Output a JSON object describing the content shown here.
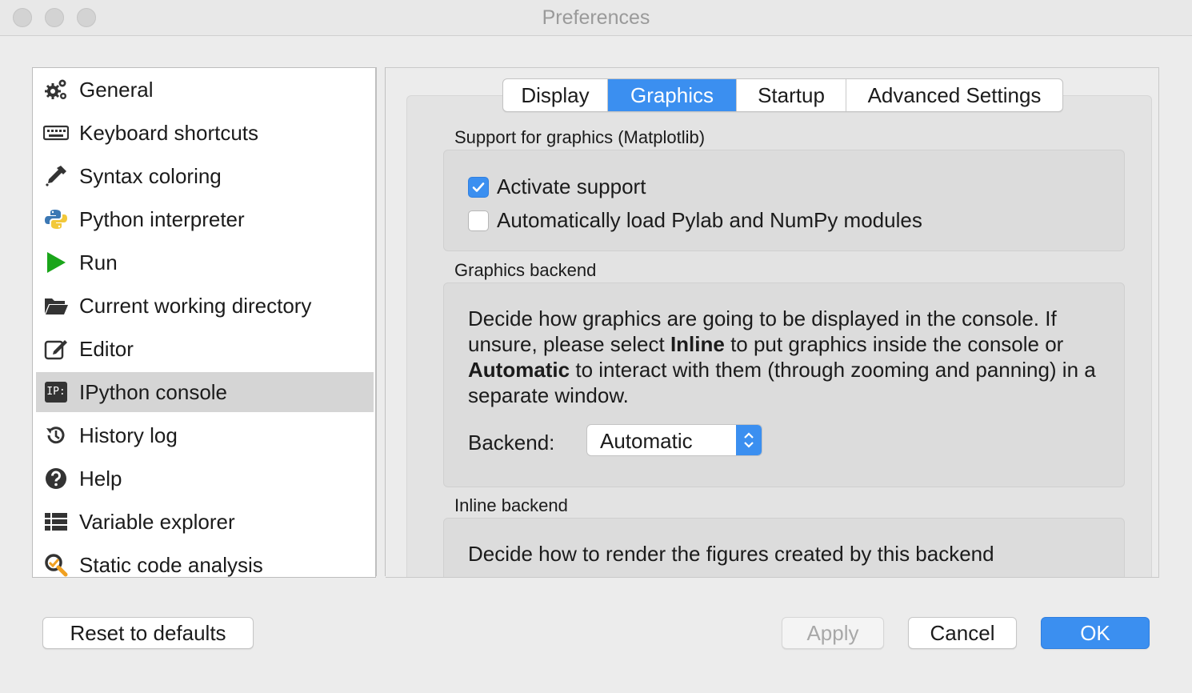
{
  "window": {
    "title": "Preferences"
  },
  "sidebar": {
    "items": [
      {
        "label": "General",
        "icon": "gears-icon"
      },
      {
        "label": "Keyboard shortcuts",
        "icon": "keyboard-icon"
      },
      {
        "label": "Syntax coloring",
        "icon": "eyedropper-icon"
      },
      {
        "label": "Python interpreter",
        "icon": "python-icon"
      },
      {
        "label": "Run",
        "icon": "play-icon"
      },
      {
        "label": "Current working directory",
        "icon": "folder-open-icon"
      },
      {
        "label": "Editor",
        "icon": "edit-icon"
      },
      {
        "label": "IPython console",
        "icon": "ipython-icon",
        "selected": true
      },
      {
        "label": "History log",
        "icon": "history-icon"
      },
      {
        "label": "Help",
        "icon": "question-icon"
      },
      {
        "label": "Variable explorer",
        "icon": "table-list-icon"
      },
      {
        "label": "Static code analysis",
        "icon": "magnifier-check-icon"
      }
    ],
    "ipython_icon_text": "IP:"
  },
  "tabs": {
    "display": "Display",
    "graphics": "Graphics",
    "startup": "Startup",
    "advanced": "Advanced Settings",
    "active": "Graphics"
  },
  "support": {
    "title": "Support for graphics (Matplotlib)",
    "activate_label": "Activate support",
    "activate_checked": true,
    "autoload_label": "Automatically load Pylab and NumPy modules",
    "autoload_checked": false
  },
  "backend_group": {
    "title": "Graphics backend",
    "desc_1": "Decide how graphics are going to be displayed in the console. If unsure, please select ",
    "desc_bold_1": "Inline",
    "desc_2": " to put graphics inside the console or ",
    "desc_bold_2": "Automatic",
    "desc_3": " to interact with them (through zooming and panning) in a separate window.",
    "backend_label": "Backend:",
    "backend_value": "Automatic"
  },
  "inline_group": {
    "title": "Inline backend",
    "desc": "Decide how to render the figures created by this backend"
  },
  "buttons": {
    "reset": "Reset to defaults",
    "apply": "Apply",
    "cancel": "Cancel",
    "ok": "OK"
  },
  "colors": {
    "accent": "#3b8ff0",
    "selection": "#d5d5d5",
    "run_green": "#1aa51a"
  }
}
